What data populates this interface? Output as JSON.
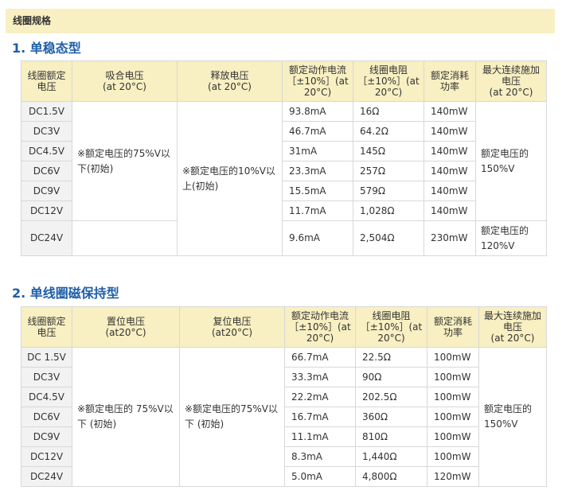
{
  "header": {
    "title": "线圈规格"
  },
  "section1": {
    "title": "1. 单稳态型",
    "headers": {
      "model": "线圈额定电压",
      "pickup": "吸合电压\n(at 20°C)",
      "release": "释放电压\n(at 20°C)",
      "current": "额定动作电流\n［±10%］(at 20°C)",
      "resistance": "线圈电阻\n［±10%］(at 20°C)",
      "power": "额定消耗\n功率",
      "maxv": "最大连续施加电压\n(at 20°C)"
    },
    "pickup_note": "※额定电压的75%V以下(初始)",
    "release_note": "※额定电压的10%V以上(初始)",
    "maxv_note_a": "额定电压的150%V",
    "maxv_note_b": "额定电压的120%V",
    "rows": [
      {
        "model": "DC1.5V",
        "current": "93.8mA",
        "resistance": "16Ω",
        "power": "140mW"
      },
      {
        "model": "DC3V",
        "current": "46.7mA",
        "resistance": "64.2Ω",
        "power": "140mW"
      },
      {
        "model": "DC4.5V",
        "current": "31mA",
        "resistance": "145Ω",
        "power": "140mW"
      },
      {
        "model": "DC6V",
        "current": "23.3mA",
        "resistance": "257Ω",
        "power": "140mW"
      },
      {
        "model": "DC9V",
        "current": "15.5mA",
        "resistance": "579Ω",
        "power": "140mW"
      },
      {
        "model": "DC12V",
        "current": "11.7mA",
        "resistance": "1,028Ω",
        "power": "140mW"
      },
      {
        "model": "DC24V",
        "current": "9.6mA",
        "resistance": "2,504Ω",
        "power": "230mW"
      }
    ]
  },
  "section2": {
    "title": "2. 单线圈磁保持型",
    "headers": {
      "model": "线圈额定电压",
      "set": "置位电压\n(at20°C)",
      "reset": "复位电压\n(at20°C)",
      "current": "额定动作电流\n［±10%］(at 20°C)",
      "resistance": "线圈电阻\n［±10%］(at 20°C)",
      "power": "额定消耗\n功率",
      "maxv": "最大连续施加电压\n(at 20°C)"
    },
    "set_note": "※额定电压的 75%V以下 (初始)",
    "reset_note": "※额定电压的75%V以下 (初始)",
    "maxv_note": "额定电压的150%V",
    "rows": [
      {
        "model": "DC 1.5V",
        "current": "66.7mA",
        "resistance": "22.5Ω",
        "power": "100mW"
      },
      {
        "model": "DC3V",
        "current": "33.3mA",
        "resistance": "90Ω",
        "power": "100mW"
      },
      {
        "model": "DC4.5V",
        "current": "22.2mA",
        "resistance": "202.5Ω",
        "power": "100mW"
      },
      {
        "model": "DC6V",
        "current": "16.7mA",
        "resistance": "360Ω",
        "power": "100mW"
      },
      {
        "model": "DC9V",
        "current": "11.1mA",
        "resistance": "810Ω",
        "power": "100mW"
      },
      {
        "model": "DC12V",
        "current": "8.3mA",
        "resistance": "1,440Ω",
        "power": "100mW"
      },
      {
        "model": "DC24V",
        "current": "5.0mA",
        "resistance": "4,800Ω",
        "power": "120mW"
      }
    ]
  }
}
